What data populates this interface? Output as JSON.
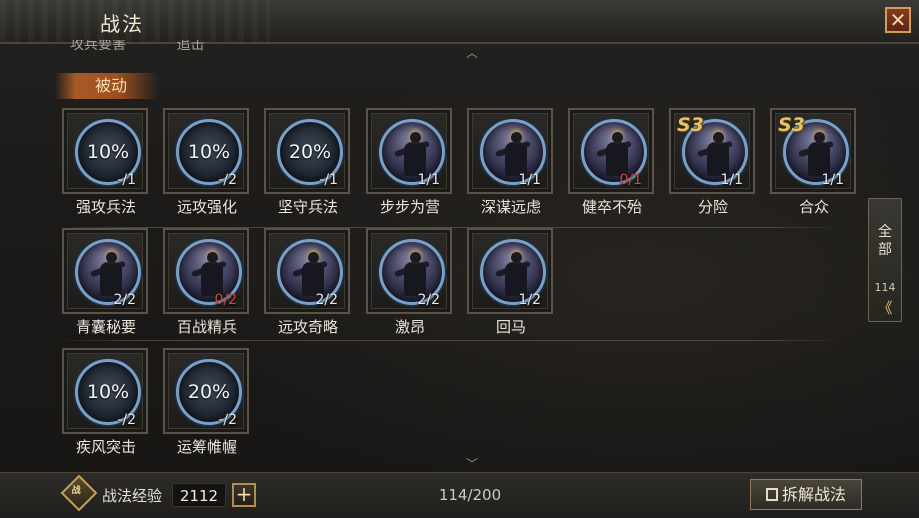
{
  "header": {
    "title": "战法",
    "close_label": "✕"
  },
  "previous_section_labels": [
    "攻兵要害",
    "追击"
  ],
  "section_tab": "被动",
  "skills": [
    {
      "name": "强攻兵法",
      "percent": "10%",
      "count": "-/1",
      "count_red": false,
      "badge": ""
    },
    {
      "name": "远攻强化",
      "percent": "10%",
      "count": "-/2",
      "count_red": false,
      "badge": ""
    },
    {
      "name": "坚守兵法",
      "percent": "20%",
      "count": "-/1",
      "count_red": false,
      "badge": ""
    },
    {
      "name": "步步为营",
      "percent": "",
      "count": "1/1",
      "count_red": false,
      "badge": ""
    },
    {
      "name": "深谋远虑",
      "percent": "",
      "count": "1/1",
      "count_red": false,
      "badge": ""
    },
    {
      "name": "健卒不殆",
      "percent": "",
      "count": "0/1",
      "count_red": true,
      "badge": ""
    },
    {
      "name": "分险",
      "percent": "",
      "count": "1/1",
      "count_red": false,
      "badge": "S3"
    },
    {
      "name": "合众",
      "percent": "",
      "count": "1/1",
      "count_red": false,
      "badge": "S3"
    },
    {
      "name": "青囊秘要",
      "percent": "",
      "count": "2/2",
      "count_red": false,
      "badge": ""
    },
    {
      "name": "百战精兵",
      "percent": "",
      "count": "0/2",
      "count_red": true,
      "badge": ""
    },
    {
      "name": "远攻奇略",
      "percent": "",
      "count": "2/2",
      "count_red": false,
      "badge": ""
    },
    {
      "name": "激昂",
      "percent": "",
      "count": "2/2",
      "count_red": false,
      "badge": ""
    },
    {
      "name": "回马",
      "percent": "",
      "count": "1/2",
      "count_red": false,
      "badge": ""
    },
    {
      "name": "疾风突击",
      "percent": "10%",
      "count": "-/2",
      "count_red": false,
      "badge": ""
    },
    {
      "name": "运筹帷幄",
      "percent": "20%",
      "count": "-/2",
      "count_red": false,
      "badge": ""
    }
  ],
  "side_filter": {
    "label": "全部",
    "count": "114",
    "arrow": "《"
  },
  "footer": {
    "exp_icon_text": "战",
    "exp_label": "战法经验",
    "exp_value": "2112",
    "plus_label": "+",
    "capacity": "114/200",
    "decompose_label": "拆解战法"
  },
  "icons": {
    "close": "close-icon",
    "scroll_up": "chevron-up-icon",
    "scroll_down": "chevron-down-icon",
    "exp": "tactic-exp-icon",
    "decompose": "decompose-icon"
  },
  "colors": {
    "accent_gold": "#c9a15d",
    "count_red": "#d8463b",
    "ring_blue": "#7aa0c6"
  }
}
